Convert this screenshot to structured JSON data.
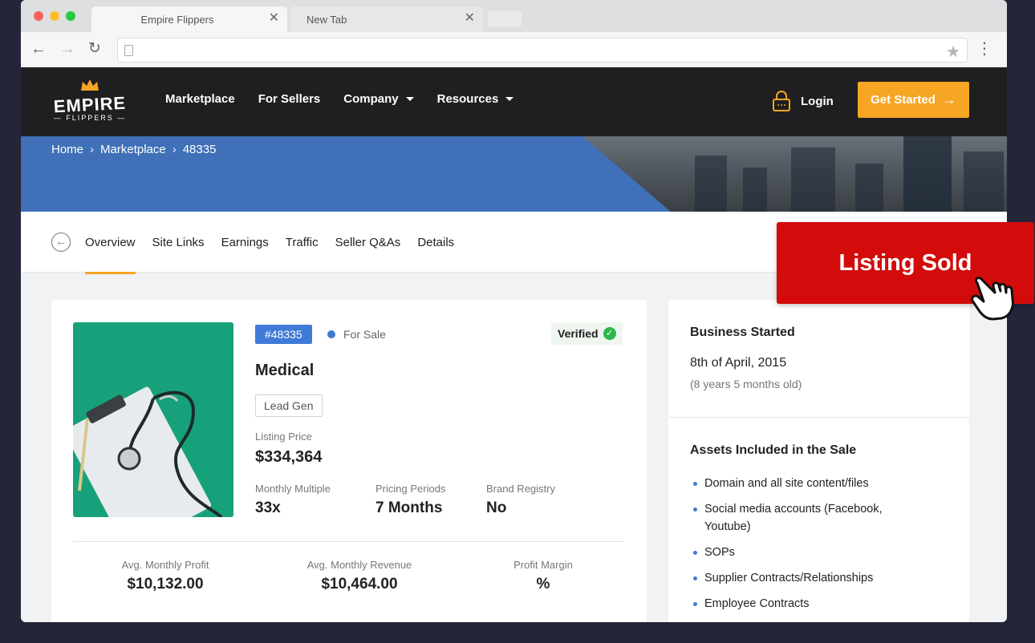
{
  "browser": {
    "tabs": [
      {
        "title": "Empire Flippers",
        "close": "✕"
      },
      {
        "title": "New Tab",
        "close": "✕"
      }
    ],
    "url": ""
  },
  "header": {
    "logo_main": "EMPIRE",
    "logo_sub": "— FLIPPERS —",
    "nav": [
      {
        "label": "Marketplace",
        "dropdown": false
      },
      {
        "label": "For Sellers",
        "dropdown": false
      },
      {
        "label": "Company",
        "dropdown": true
      },
      {
        "label": "Resources",
        "dropdown": true
      }
    ],
    "login": "Login",
    "cta": "Get Started",
    "accent": "#f6a623"
  },
  "breadcrumb": [
    "Home",
    "Marketplace",
    "48335"
  ],
  "breadcrumb_sep": "›",
  "subnav": {
    "tabs": [
      "Overview",
      "Site Links",
      "Earnings",
      "Traffic",
      "Seller Q&As",
      "Details"
    ],
    "active": "Overview"
  },
  "sold_badge": "Listing Sold",
  "listing": {
    "id": "#48335",
    "status": "For Sale",
    "verified": "Verified",
    "niche": "Medical",
    "monetization": "Lead Gen",
    "listing_price_label": "Listing Price",
    "listing_price": "$334,364",
    "metrics": [
      {
        "label": "Monthly Multiple",
        "value": "33x"
      },
      {
        "label": "Pricing Periods",
        "value": "7 Months"
      },
      {
        "label": "Brand Registry",
        "value": "No"
      }
    ],
    "stats": [
      {
        "label": "Avg. Monthly Profit",
        "value": "$10,132.00"
      },
      {
        "label": "Avg. Monthly Revenue",
        "value": "$10,464.00"
      },
      {
        "label": "Profit Margin",
        "value": "%"
      }
    ]
  },
  "sidebar": {
    "business_started_title": "Business Started",
    "business_started_date": "8th of April, 2015",
    "business_age": "(8 years 5 months old)",
    "assets_title": "Assets Included in the Sale",
    "assets": [
      "Domain and all site content/files",
      "Social media accounts (Facebook, Youtube)",
      "SOPs",
      "Supplier Contracts/Relationships",
      "Employee Contracts"
    ]
  },
  "colors": {
    "sold_red": "#d30b0b",
    "brand_blue": "#3f7ad6",
    "verified_green": "#2eb84a",
    "header_bg": "#1f1f22"
  }
}
